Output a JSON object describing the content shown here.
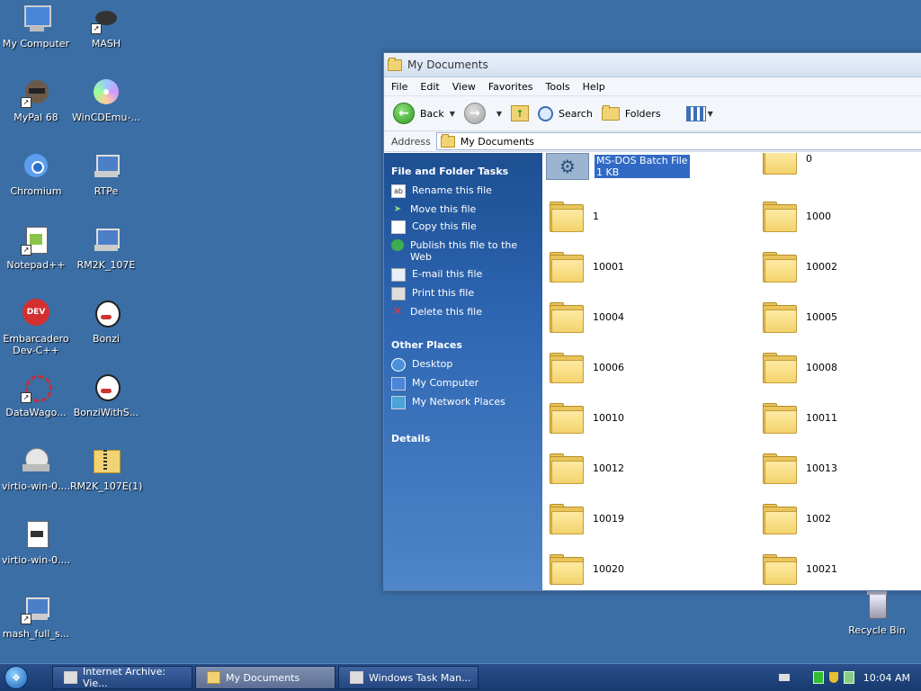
{
  "desktop": {
    "icons": [
      {
        "label": "My Computer"
      },
      {
        "label": "MASH"
      },
      {
        "label": "MyPal 68"
      },
      {
        "label": "WinCDEmu-..."
      },
      {
        "label": "Chromium"
      },
      {
        "label": "RTPe"
      },
      {
        "label": "Notepad++"
      },
      {
        "label": "RM2K_107E"
      },
      {
        "label": "Embarcadero Dev-C++"
      },
      {
        "label": "Bonzi"
      },
      {
        "label": "DataWago..."
      },
      {
        "label": "BonziWithS..."
      },
      {
        "label": "virtio-win-0...."
      },
      {
        "label": "RM2K_107E(1)"
      },
      {
        "label": "virtio-win-0...."
      },
      {
        "label": "mash_full_s..."
      },
      {
        "label": "Recycle Bin"
      }
    ]
  },
  "window": {
    "title": "My Documents",
    "menu": [
      "File",
      "Edit",
      "View",
      "Favorites",
      "Tools",
      "Help"
    ],
    "toolbar": {
      "back": "Back",
      "search": "Search",
      "folders": "Folders"
    },
    "address": {
      "label": "Address",
      "value": "My Documents"
    }
  },
  "taskpane": {
    "file_tasks_title": "File and Folder Tasks",
    "file_tasks": [
      "Rename this file",
      "Move this file",
      "Copy this file",
      "Publish this file to the Web",
      "E-mail this file",
      "Print this file",
      "Delete this file"
    ],
    "other_places_title": "Other Places",
    "other_places": [
      "Desktop",
      "My Computer",
      "My Network Places"
    ],
    "details_title": "Details"
  },
  "files": {
    "selected": {
      "type_label": "MS-DOS Batch File",
      "size": "1 KB"
    },
    "folders": [
      "0",
      "1",
      "1000",
      "10001",
      "10002",
      "10004",
      "10005",
      "10006",
      "10008",
      "10010",
      "10011",
      "10012",
      "10013",
      "10019",
      "1002",
      "10020",
      "10021"
    ]
  },
  "taskbar": {
    "buttons": [
      "Internet Archive: Vie...",
      "My Documents",
      "Windows Task Man..."
    ],
    "clock": "10:04 AM"
  }
}
